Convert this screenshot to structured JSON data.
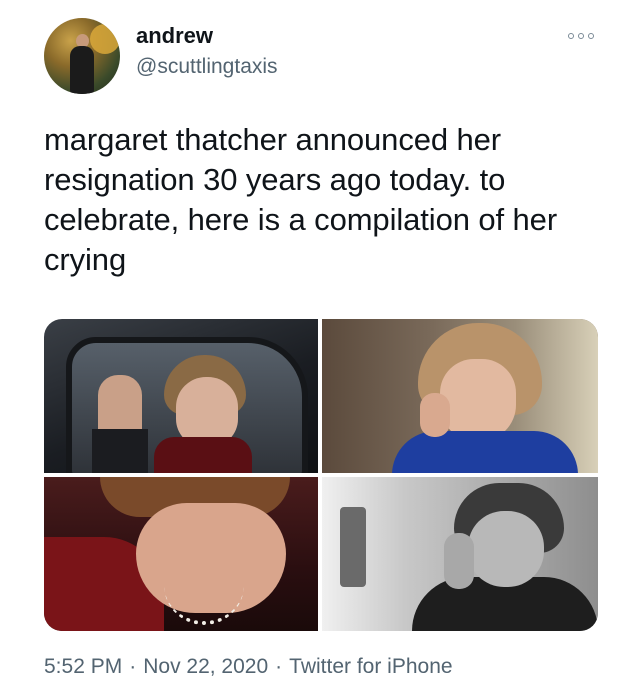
{
  "user": {
    "display_name": "andrew",
    "handle": "@scuttlingtaxis"
  },
  "tweet": {
    "text": "margaret thatcher announced her resignation 30 years ago today. to celebrate, here is a compilation of her crying"
  },
  "media": {
    "photo_count": 4
  },
  "meta": {
    "time": "5:52 PM",
    "separator": "·",
    "date": "Nov 22, 2020",
    "source": "Twitter for iPhone"
  },
  "icons": {
    "more": "more-options-icon"
  },
  "colors": {
    "text": "#0f1419",
    "secondary": "#536471"
  }
}
